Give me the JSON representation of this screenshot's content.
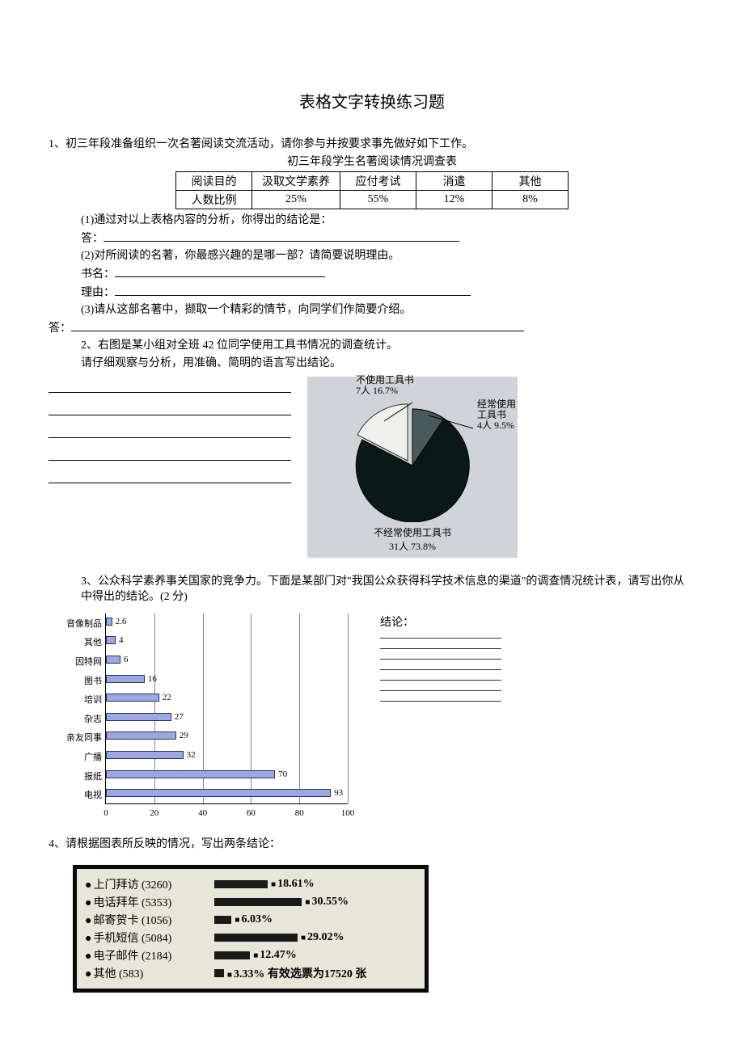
{
  "title": "表格文字转换练习题",
  "q1": {
    "intro": "1、初三年段准备组织一次名著阅读交流活动，请你参与并按要求事先做好如下工作。",
    "table_caption": "初三年段学生名著阅读情况调查表",
    "headers": [
      "阅读目的",
      "汲取文学素养",
      "应付考试",
      "消遣",
      "其他"
    ],
    "row_label": "人数比例",
    "values": [
      "25%",
      "55%",
      "12%",
      "8%"
    ],
    "sub1": "(1)通过对以上表格内容的分析，你得出的结论是：",
    "ans_label": "答：",
    "sub2": "(2)对所阅读的名著，你最感兴趣的是哪一部？请简要说明理由。",
    "book_label": "书名：",
    "reason_label": "理由：",
    "sub3": "(3)请从这部名著中，撷取一个精彩的情节，向同学们作简要介绍。"
  },
  "q2": {
    "intro1": "2、右图是某小组对全班 42 位同学使用工具书情况的调查统计。",
    "intro2": "请仔细观察与分析，用准确、简明的语言写出结论。",
    "chart_data": {
      "type": "pie",
      "title": "",
      "series": [
        {
          "name": "不使用工具书",
          "count": 7,
          "pct": 16.7
        },
        {
          "name": "经常使用工具书",
          "count": 4,
          "pct": 9.5
        },
        {
          "name": "不经常使用工具书",
          "count": 31,
          "pct": 73.8
        }
      ]
    },
    "label_top": "不使用工具书",
    "label_top2": "7人 16.7%",
    "label_right": "经常使用",
    "label_right2": "工具书",
    "label_right3": "4人 9.5%",
    "label_bottom": "不经常使用工具书",
    "label_bottom2": "31人 73.8%"
  },
  "q3": {
    "intro": "3、公众科学素养事关国家的竞争力。下面是某部门对\"我国公众获得科学技术信息的渠道\"的调查情况统计表，请写出你从中得出的结论。(2 分)",
    "conc_label": "结论：",
    "chart_data": {
      "type": "bar",
      "orientation": "horizontal",
      "xlabel": "",
      "ylabel": "",
      "xlim": [
        0,
        100
      ],
      "xticks": [
        0,
        20,
        40,
        60,
        80,
        100
      ],
      "categories": [
        "音像制品",
        "其他",
        "因特网",
        "图书",
        "培训",
        "杂志",
        "亲友同事",
        "广播",
        "报纸",
        "电视"
      ],
      "values": [
        2.6,
        4,
        6,
        16,
        22,
        27,
        29,
        32,
        70,
        93
      ]
    }
  },
  "q4": {
    "intro": "4、请根据图表所反映的情况，写出两条结论：",
    "chart_data": {
      "type": "bar",
      "orientation": "horizontal",
      "footnote": "有效选票为17520 张",
      "series": [
        {
          "name": "上门拜访",
          "count": 3260,
          "pct": 18.61
        },
        {
          "name": "电话拜年",
          "count": 5353,
          "pct": 30.55
        },
        {
          "name": "邮寄贺卡",
          "count": 1056,
          "pct": 6.03
        },
        {
          "name": "手机短信",
          "count": 5084,
          "pct": 29.02
        },
        {
          "name": "电子邮件",
          "count": 2184,
          "pct": 12.47
        },
        {
          "name": "其他",
          "count": 583,
          "pct": 3.33
        }
      ]
    }
  }
}
